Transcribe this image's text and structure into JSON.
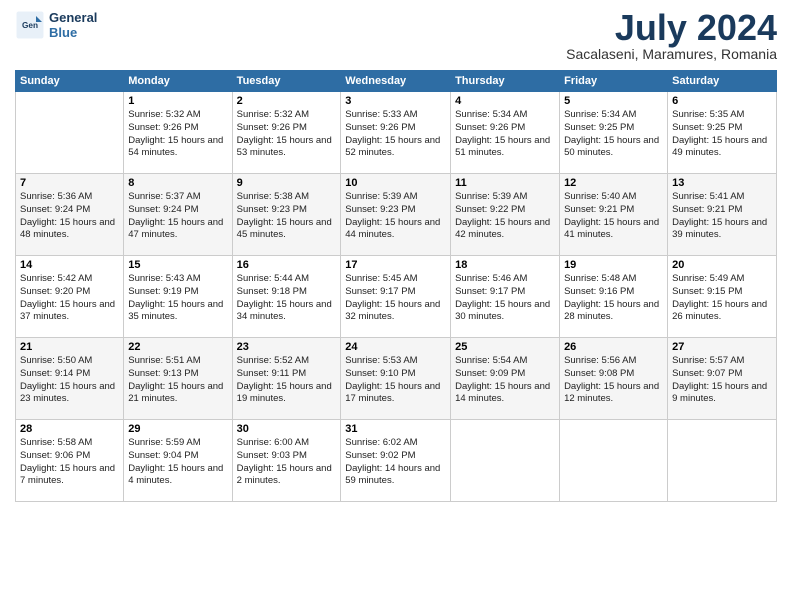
{
  "header": {
    "logo_line1": "General",
    "logo_line2": "Blue",
    "month_title": "July 2024",
    "subtitle": "Sacalaseni, Maramures, Romania"
  },
  "days_of_week": [
    "Sunday",
    "Monday",
    "Tuesday",
    "Wednesday",
    "Thursday",
    "Friday",
    "Saturday"
  ],
  "weeks": [
    [
      {
        "day": "",
        "info": ""
      },
      {
        "day": "1",
        "info": "Sunrise: 5:32 AM\nSunset: 9:26 PM\nDaylight: 15 hours\nand 54 minutes."
      },
      {
        "day": "2",
        "info": "Sunrise: 5:32 AM\nSunset: 9:26 PM\nDaylight: 15 hours\nand 53 minutes."
      },
      {
        "day": "3",
        "info": "Sunrise: 5:33 AM\nSunset: 9:26 PM\nDaylight: 15 hours\nand 52 minutes."
      },
      {
        "day": "4",
        "info": "Sunrise: 5:34 AM\nSunset: 9:26 PM\nDaylight: 15 hours\nand 51 minutes."
      },
      {
        "day": "5",
        "info": "Sunrise: 5:34 AM\nSunset: 9:25 PM\nDaylight: 15 hours\nand 50 minutes."
      },
      {
        "day": "6",
        "info": "Sunrise: 5:35 AM\nSunset: 9:25 PM\nDaylight: 15 hours\nand 49 minutes."
      }
    ],
    [
      {
        "day": "7",
        "info": "Sunrise: 5:36 AM\nSunset: 9:24 PM\nDaylight: 15 hours\nand 48 minutes."
      },
      {
        "day": "8",
        "info": "Sunrise: 5:37 AM\nSunset: 9:24 PM\nDaylight: 15 hours\nand 47 minutes."
      },
      {
        "day": "9",
        "info": "Sunrise: 5:38 AM\nSunset: 9:23 PM\nDaylight: 15 hours\nand 45 minutes."
      },
      {
        "day": "10",
        "info": "Sunrise: 5:39 AM\nSunset: 9:23 PM\nDaylight: 15 hours\nand 44 minutes."
      },
      {
        "day": "11",
        "info": "Sunrise: 5:39 AM\nSunset: 9:22 PM\nDaylight: 15 hours\nand 42 minutes."
      },
      {
        "day": "12",
        "info": "Sunrise: 5:40 AM\nSunset: 9:21 PM\nDaylight: 15 hours\nand 41 minutes."
      },
      {
        "day": "13",
        "info": "Sunrise: 5:41 AM\nSunset: 9:21 PM\nDaylight: 15 hours\nand 39 minutes."
      }
    ],
    [
      {
        "day": "14",
        "info": "Sunrise: 5:42 AM\nSunset: 9:20 PM\nDaylight: 15 hours\nand 37 minutes."
      },
      {
        "day": "15",
        "info": "Sunrise: 5:43 AM\nSunset: 9:19 PM\nDaylight: 15 hours\nand 35 minutes."
      },
      {
        "day": "16",
        "info": "Sunrise: 5:44 AM\nSunset: 9:18 PM\nDaylight: 15 hours\nand 34 minutes."
      },
      {
        "day": "17",
        "info": "Sunrise: 5:45 AM\nSunset: 9:17 PM\nDaylight: 15 hours\nand 32 minutes."
      },
      {
        "day": "18",
        "info": "Sunrise: 5:46 AM\nSunset: 9:17 PM\nDaylight: 15 hours\nand 30 minutes."
      },
      {
        "day": "19",
        "info": "Sunrise: 5:48 AM\nSunset: 9:16 PM\nDaylight: 15 hours\nand 28 minutes."
      },
      {
        "day": "20",
        "info": "Sunrise: 5:49 AM\nSunset: 9:15 PM\nDaylight: 15 hours\nand 26 minutes."
      }
    ],
    [
      {
        "day": "21",
        "info": "Sunrise: 5:50 AM\nSunset: 9:14 PM\nDaylight: 15 hours\nand 23 minutes."
      },
      {
        "day": "22",
        "info": "Sunrise: 5:51 AM\nSunset: 9:13 PM\nDaylight: 15 hours\nand 21 minutes."
      },
      {
        "day": "23",
        "info": "Sunrise: 5:52 AM\nSunset: 9:11 PM\nDaylight: 15 hours\nand 19 minutes."
      },
      {
        "day": "24",
        "info": "Sunrise: 5:53 AM\nSunset: 9:10 PM\nDaylight: 15 hours\nand 17 minutes."
      },
      {
        "day": "25",
        "info": "Sunrise: 5:54 AM\nSunset: 9:09 PM\nDaylight: 15 hours\nand 14 minutes."
      },
      {
        "day": "26",
        "info": "Sunrise: 5:56 AM\nSunset: 9:08 PM\nDaylight: 15 hours\nand 12 minutes."
      },
      {
        "day": "27",
        "info": "Sunrise: 5:57 AM\nSunset: 9:07 PM\nDaylight: 15 hours\nand 9 minutes."
      }
    ],
    [
      {
        "day": "28",
        "info": "Sunrise: 5:58 AM\nSunset: 9:06 PM\nDaylight: 15 hours\nand 7 minutes."
      },
      {
        "day": "29",
        "info": "Sunrise: 5:59 AM\nSunset: 9:04 PM\nDaylight: 15 hours\nand 4 minutes."
      },
      {
        "day": "30",
        "info": "Sunrise: 6:00 AM\nSunset: 9:03 PM\nDaylight: 15 hours\nand 2 minutes."
      },
      {
        "day": "31",
        "info": "Sunrise: 6:02 AM\nSunset: 9:02 PM\nDaylight: 14 hours\nand 59 minutes."
      },
      {
        "day": "",
        "info": ""
      },
      {
        "day": "",
        "info": ""
      },
      {
        "day": "",
        "info": ""
      }
    ]
  ]
}
